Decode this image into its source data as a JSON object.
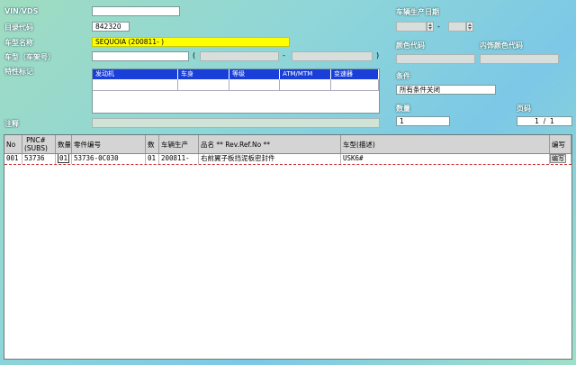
{
  "labels": {
    "vin": "VIN/VDS",
    "catalog": "目录代码",
    "model_name": "车型名称",
    "model_frame": "车型（车架号）",
    "special": "特性标记",
    "note": "注释",
    "prod_date": "车辆生产日期",
    "color_code": "颜色代码",
    "interior_color": "内饰颜色代码",
    "condition": "条件",
    "quantity": "数量",
    "page": "页码"
  },
  "fields": {
    "vin": "",
    "catalog": "842320",
    "model_name": "SEQUOIA        (200811-    )",
    "model_a": "",
    "model_b": "",
    "model_c": "",
    "note": "",
    "date_from": "",
    "date_to": "",
    "date_sep": "-",
    "color_code": "",
    "interior_color": "",
    "condition": "所有条件关闭",
    "quantity": "1",
    "page_current": "1",
    "page_sep": "/",
    "page_total": "1"
  },
  "feature_headers": [
    "发动机",
    "车身",
    "等级",
    "ATM/MTM",
    "变速器"
  ],
  "grid": {
    "headers": [
      "No",
      "PNC#\n(SUBS)",
      "数量",
      "零件编号",
      "数",
      "车辆生产",
      "品名 ** Rev.Ref.No **",
      "车型(描述)",
      "编写"
    ],
    "rows": [
      {
        "no": "001",
        "pnc": "53736",
        "qty": "01",
        "part": "53736-0C030",
        "n": "01",
        "prod": "200811-",
        "name": "右前翼子板挡泥板密封件",
        "model": "USK6#",
        "edit": "编写"
      }
    ]
  },
  "colors": {
    "header_blue": "#1a3fd8",
    "yellow": "#ffff00"
  }
}
